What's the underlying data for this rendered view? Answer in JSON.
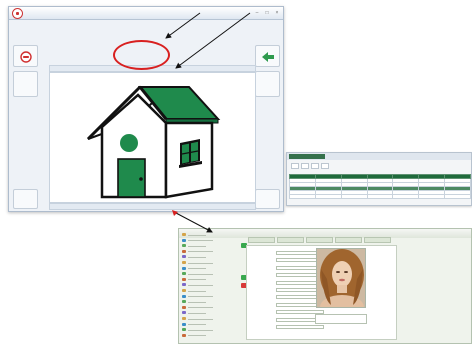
{
  "colors": {
    "house_roof": "#1f8a4c",
    "window_frame": "#1f8a4c",
    "header_green": "#1f6a3c",
    "annotation_red": "#d82020",
    "forward_arrow": "#2e9a4e",
    "back_icon": "#d03030"
  },
  "main_window": {
    "title": "",
    "info_lines": [
      "",
      "",
      ""
    ],
    "left_buttons": [
      "",
      ""
    ],
    "right_buttons": [
      "",
      ""
    ],
    "top_strip": "",
    "bottom_strip": "",
    "icons": {
      "app": "app-logo-icon",
      "back": "back-circle-icon",
      "forward": "forward-arrow-icon",
      "illustration": "house-icon"
    }
  },
  "table_window": {
    "tab_label": "",
    "columns": [
      "",
      "",
      "",
      "",
      "",
      "",
      ""
    ],
    "rows": [
      [
        "",
        "",
        "",
        "",
        "",
        "",
        ""
      ],
      [
        "",
        "",
        "",
        "",
        "",
        "",
        ""
      ],
      [
        "",
        "",
        "",
        "",
        "",
        "",
        ""
      ],
      [
        "",
        "",
        "",
        "",
        "",
        "",
        ""
      ],
      [
        "",
        "",
        "",
        "",
        "",
        "",
        ""
      ]
    ],
    "selected_row": 2
  },
  "form_window": {
    "title": "",
    "tree_items": 19,
    "tabs": [
      "",
      "",
      "",
      "",
      ""
    ],
    "fields": [
      {
        "label": "",
        "value": ""
      },
      {
        "label": "",
        "value": ""
      },
      {
        "label": "",
        "value": ""
      },
      {
        "label": "",
        "value": ""
      },
      {
        "label": "",
        "value": ""
      },
      {
        "label": "",
        "value": ""
      },
      {
        "label": "",
        "value": ""
      },
      {
        "label": "",
        "value": ""
      },
      {
        "label": "",
        "value": ""
      },
      {
        "label": "",
        "value": ""
      },
      {
        "label": "",
        "value": ""
      }
    ],
    "photo_button": "",
    "icons": {
      "photo": "portrait-photo"
    }
  },
  "annotations": {
    "arrow_marks": [
      "",
      ""
    ]
  }
}
